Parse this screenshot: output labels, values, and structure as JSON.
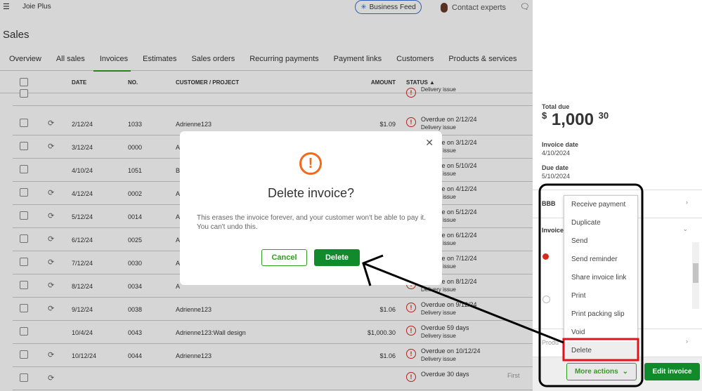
{
  "topbar": {
    "app_name": "Joie Plus",
    "business_feed": "Business Feed",
    "contact": "Contact experts"
  },
  "page_title": "Sales",
  "tabs": [
    "Overview",
    "All sales",
    "Invoices",
    "Estimates",
    "Sales orders",
    "Recurring payments",
    "Payment links",
    "Customers",
    "Products & services"
  ],
  "active_tab": "Invoices",
  "table": {
    "headers": {
      "date": "DATE",
      "no": "NO.",
      "customer": "CUSTOMER / PROJECT",
      "amount": "AMOUNT",
      "status": "STATUS ▲"
    },
    "rows": [
      {
        "date": "",
        "no": "",
        "customer": "",
        "amount": "",
        "status": "",
        "sub": "Delivery issue",
        "recurring": false
      },
      {
        "date": "2/12/24",
        "no": "1033",
        "customer": "Adrienne123",
        "amount": "$1.09",
        "status": "Overdue on 2/12/24",
        "sub": "Delivery issue",
        "recurring": true
      },
      {
        "date": "3/12/24",
        "no": "0000",
        "customer": "A",
        "amount": "",
        "status": "Overdue on 3/12/24",
        "sub": "Delivery issue",
        "recurring": true
      },
      {
        "date": "4/10/24",
        "no": "1051",
        "customer": "B",
        "amount": "",
        "status": "Overdue on 5/10/24",
        "sub": "Delivery issue",
        "recurring": false
      },
      {
        "date": "4/12/24",
        "no": "0002",
        "customer": "A",
        "amount": "",
        "status": "Overdue on 4/12/24",
        "sub": "Delivery issue",
        "recurring": true
      },
      {
        "date": "5/12/24",
        "no": "0014",
        "customer": "A",
        "amount": "",
        "status": "Overdue on 5/12/24",
        "sub": "Delivery issue",
        "recurring": true
      },
      {
        "date": "6/12/24",
        "no": "0025",
        "customer": "A",
        "amount": "",
        "status": "Overdue on 6/12/24",
        "sub": "Delivery issue",
        "recurring": true
      },
      {
        "date": "7/12/24",
        "no": "0030",
        "customer": "A",
        "amount": "",
        "status": "Overdue on 7/12/24",
        "sub": "Delivery issue",
        "recurring": true
      },
      {
        "date": "8/12/24",
        "no": "0034",
        "customer": "A",
        "amount": "",
        "status": "Overdue on 8/12/24",
        "sub": "Delivery issue",
        "recurring": true
      },
      {
        "date": "9/12/24",
        "no": "0038",
        "customer": "Adrienne123",
        "amount": "$1.06",
        "status": "Overdue on 9/12/24",
        "sub": "Delivery issue",
        "recurring": true
      },
      {
        "date": "10/4/24",
        "no": "0043",
        "customer": "Adrienne123:Wall design",
        "amount": "$1,000.30",
        "status": "Overdue 59 days",
        "sub": "Delivery issue",
        "recurring": false
      },
      {
        "date": "10/12/24",
        "no": "0044",
        "customer": "Adrienne123",
        "amount": "$1.06",
        "status": "Overdue on 10/12/24",
        "sub": "Delivery issue",
        "recurring": true
      },
      {
        "date": "",
        "no": "",
        "customer": "",
        "amount": "",
        "status": "Overdue 30 days",
        "sub": "",
        "recurring": true
      }
    ]
  },
  "pagination": {
    "first": "First"
  },
  "modal": {
    "title": "Delete invoice?",
    "message": "This erases the invoice forever, and your customer won't be able to pay it. You can't undo this.",
    "cancel": "Cancel",
    "delete": "Delete"
  },
  "panel": {
    "total_label": "Total due",
    "currency": "$",
    "total_whole": "1,000",
    "total_cents": "30",
    "invoice_date_label": "Invoice date",
    "invoice_date": "4/10/2024",
    "due_date_label": "Due date",
    "due_date": "5/10/2024",
    "customer": "BBB",
    "section_invoice": "Invoice",
    "section_products": "Produ"
  },
  "menu": {
    "items": [
      "Receive payment",
      "Duplicate",
      "Send",
      "Send reminder",
      "Share invoice link",
      "Print",
      "Print packing slip",
      "Void",
      "Delete"
    ],
    "highlighted": "Delete"
  },
  "footer": {
    "more_actions": "More actions",
    "edit_invoice": "Edit invoice"
  },
  "colors": {
    "accent": "#2ca01c",
    "primary_button": "#108a2a",
    "warning": "#d52b1e",
    "modal_icon": "#f26a1b",
    "highlight_box": "#e0141e"
  }
}
